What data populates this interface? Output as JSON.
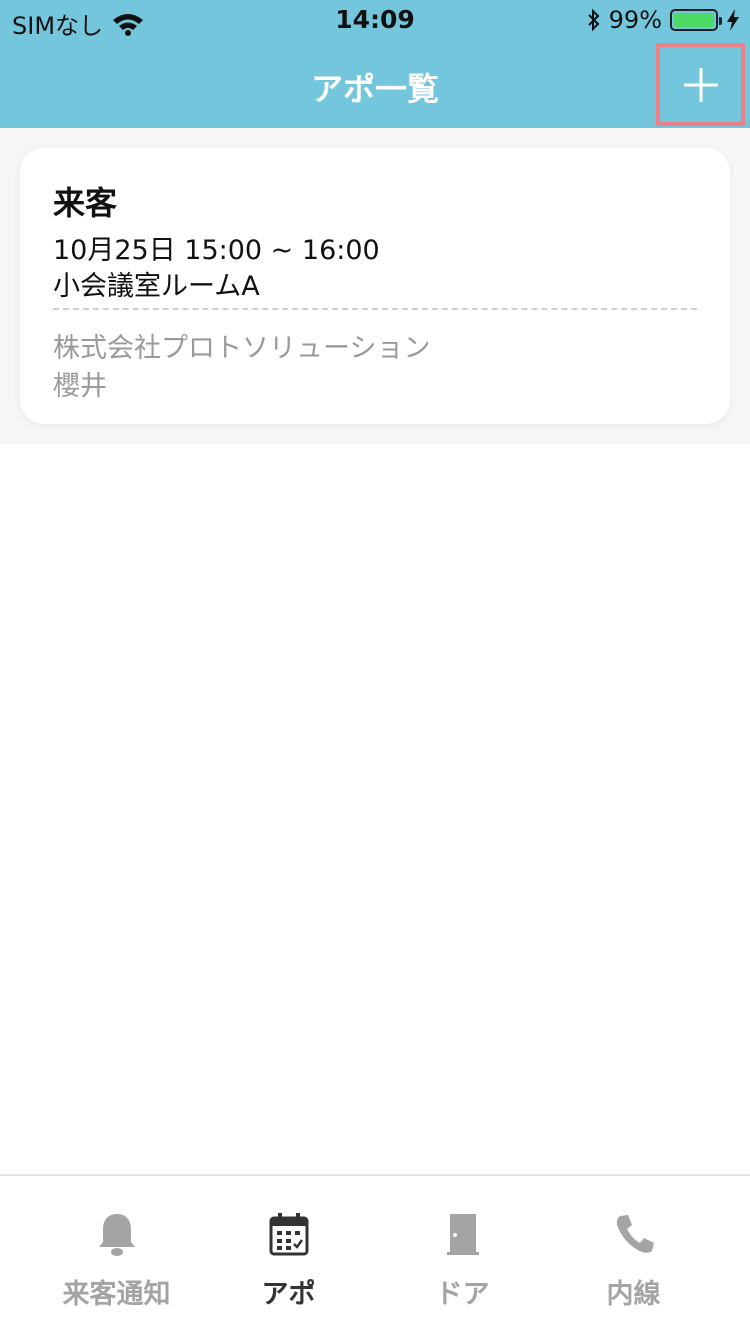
{
  "status_bar": {
    "carrier": "SIMなし",
    "time": "14:09",
    "battery": "99%"
  },
  "header": {
    "title": "アポ一覧",
    "add_icon": "plus-icon"
  },
  "appointments": [
    {
      "type": "来客",
      "datetime": "10月25日 15:00 ~ 16:00",
      "room": "小会議室ルームA",
      "company": "株式会社プロトソリューション",
      "person": "櫻井"
    }
  ],
  "tabs": [
    {
      "label": "来客通知",
      "icon": "bell-icon",
      "active": false
    },
    {
      "label": "アポ",
      "icon": "calendar-icon",
      "active": true
    },
    {
      "label": "ドア",
      "icon": "door-icon",
      "active": false
    },
    {
      "label": "内線",
      "icon": "phone-icon",
      "active": false
    }
  ],
  "colors": {
    "header": "#74c6dd",
    "highlight_border": "#ef7f89",
    "battery": "#4cd964",
    "tab_active": "#333333",
    "tab_inactive": "#a4a4a4"
  }
}
